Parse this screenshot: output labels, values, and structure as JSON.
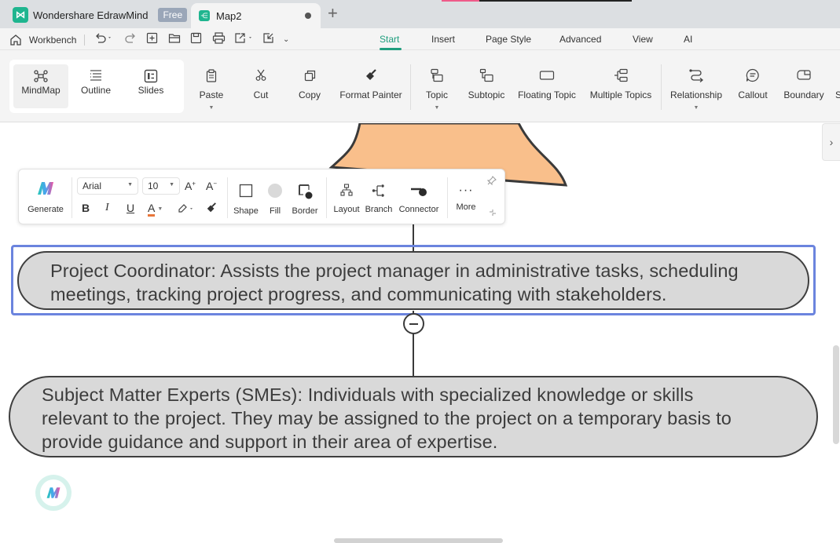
{
  "titlebar": {
    "app_name": "Wondershare EdrawMind",
    "plan_badge": "Free",
    "doc_tab": "Map2",
    "new_tab": "+"
  },
  "quick_access": {
    "workbench": "Workbench"
  },
  "menu_tabs": [
    {
      "label": "Start",
      "active": true
    },
    {
      "label": "Insert"
    },
    {
      "label": "Page Style"
    },
    {
      "label": "Advanced"
    },
    {
      "label": "View"
    },
    {
      "label": "AI"
    }
  ],
  "view_switch": [
    {
      "label": "MindMap",
      "icon": "mindmap-icon",
      "active": true
    },
    {
      "label": "Outline",
      "icon": "outline-icon"
    },
    {
      "label": "Slides",
      "icon": "slides-icon"
    }
  ],
  "ribbon": [
    {
      "label": "Paste",
      "icon": "paste-icon",
      "dropdown": true
    },
    {
      "label": "Cut",
      "icon": "cut-icon"
    },
    {
      "label": "Copy",
      "icon": "copy-icon"
    },
    {
      "label": "Format Painter",
      "icon": "format-painter-icon"
    },
    {
      "label": "Topic",
      "icon": "topic-icon",
      "dropdown": true
    },
    {
      "label": "Subtopic",
      "icon": "subtopic-icon"
    },
    {
      "label": "Floating Topic",
      "icon": "floating-topic-icon"
    },
    {
      "label": "Multiple Topics",
      "icon": "multiple-topics-icon"
    },
    {
      "label": "Relationship",
      "icon": "relationship-icon",
      "dropdown": true
    },
    {
      "label": "Callout",
      "icon": "callout-icon"
    },
    {
      "label": "Boundary",
      "icon": "boundary-icon"
    }
  ],
  "float_toolbar": {
    "generate": "Generate",
    "font_family": "Arial",
    "font_size": "10",
    "increase_font": "A+",
    "decrease_font": "A-",
    "bold": "B",
    "italic": "I",
    "underline": "U",
    "font_color": "A",
    "font_color_hex": "#e8763a",
    "shape": "Shape",
    "fill": "Fill",
    "border": "Border",
    "layout": "Layout",
    "branch": "Branch",
    "connector": "Connector",
    "more": "More"
  },
  "mindmap": {
    "parent_fill": "#f9bf8b",
    "nodes": [
      {
        "id": "project-coordinator",
        "lines": [
          "Project Coordinator: Assists the project manager in administrative tasks, scheduling",
          "meetings, tracking project progress, and communicating with stakeholders."
        ],
        "selected": true
      },
      {
        "id": "subject-matter-experts",
        "lines": [
          "Subject Matter Experts (SMEs): Individuals with specialized knowledge or skills",
          "relevant to the project. They may be assigned to the project on a temporary basis to",
          "provide guidance and support in their area of expertise."
        ]
      }
    ],
    "selection_color": "#6b84de",
    "node_fill": "#d9d9d9"
  }
}
